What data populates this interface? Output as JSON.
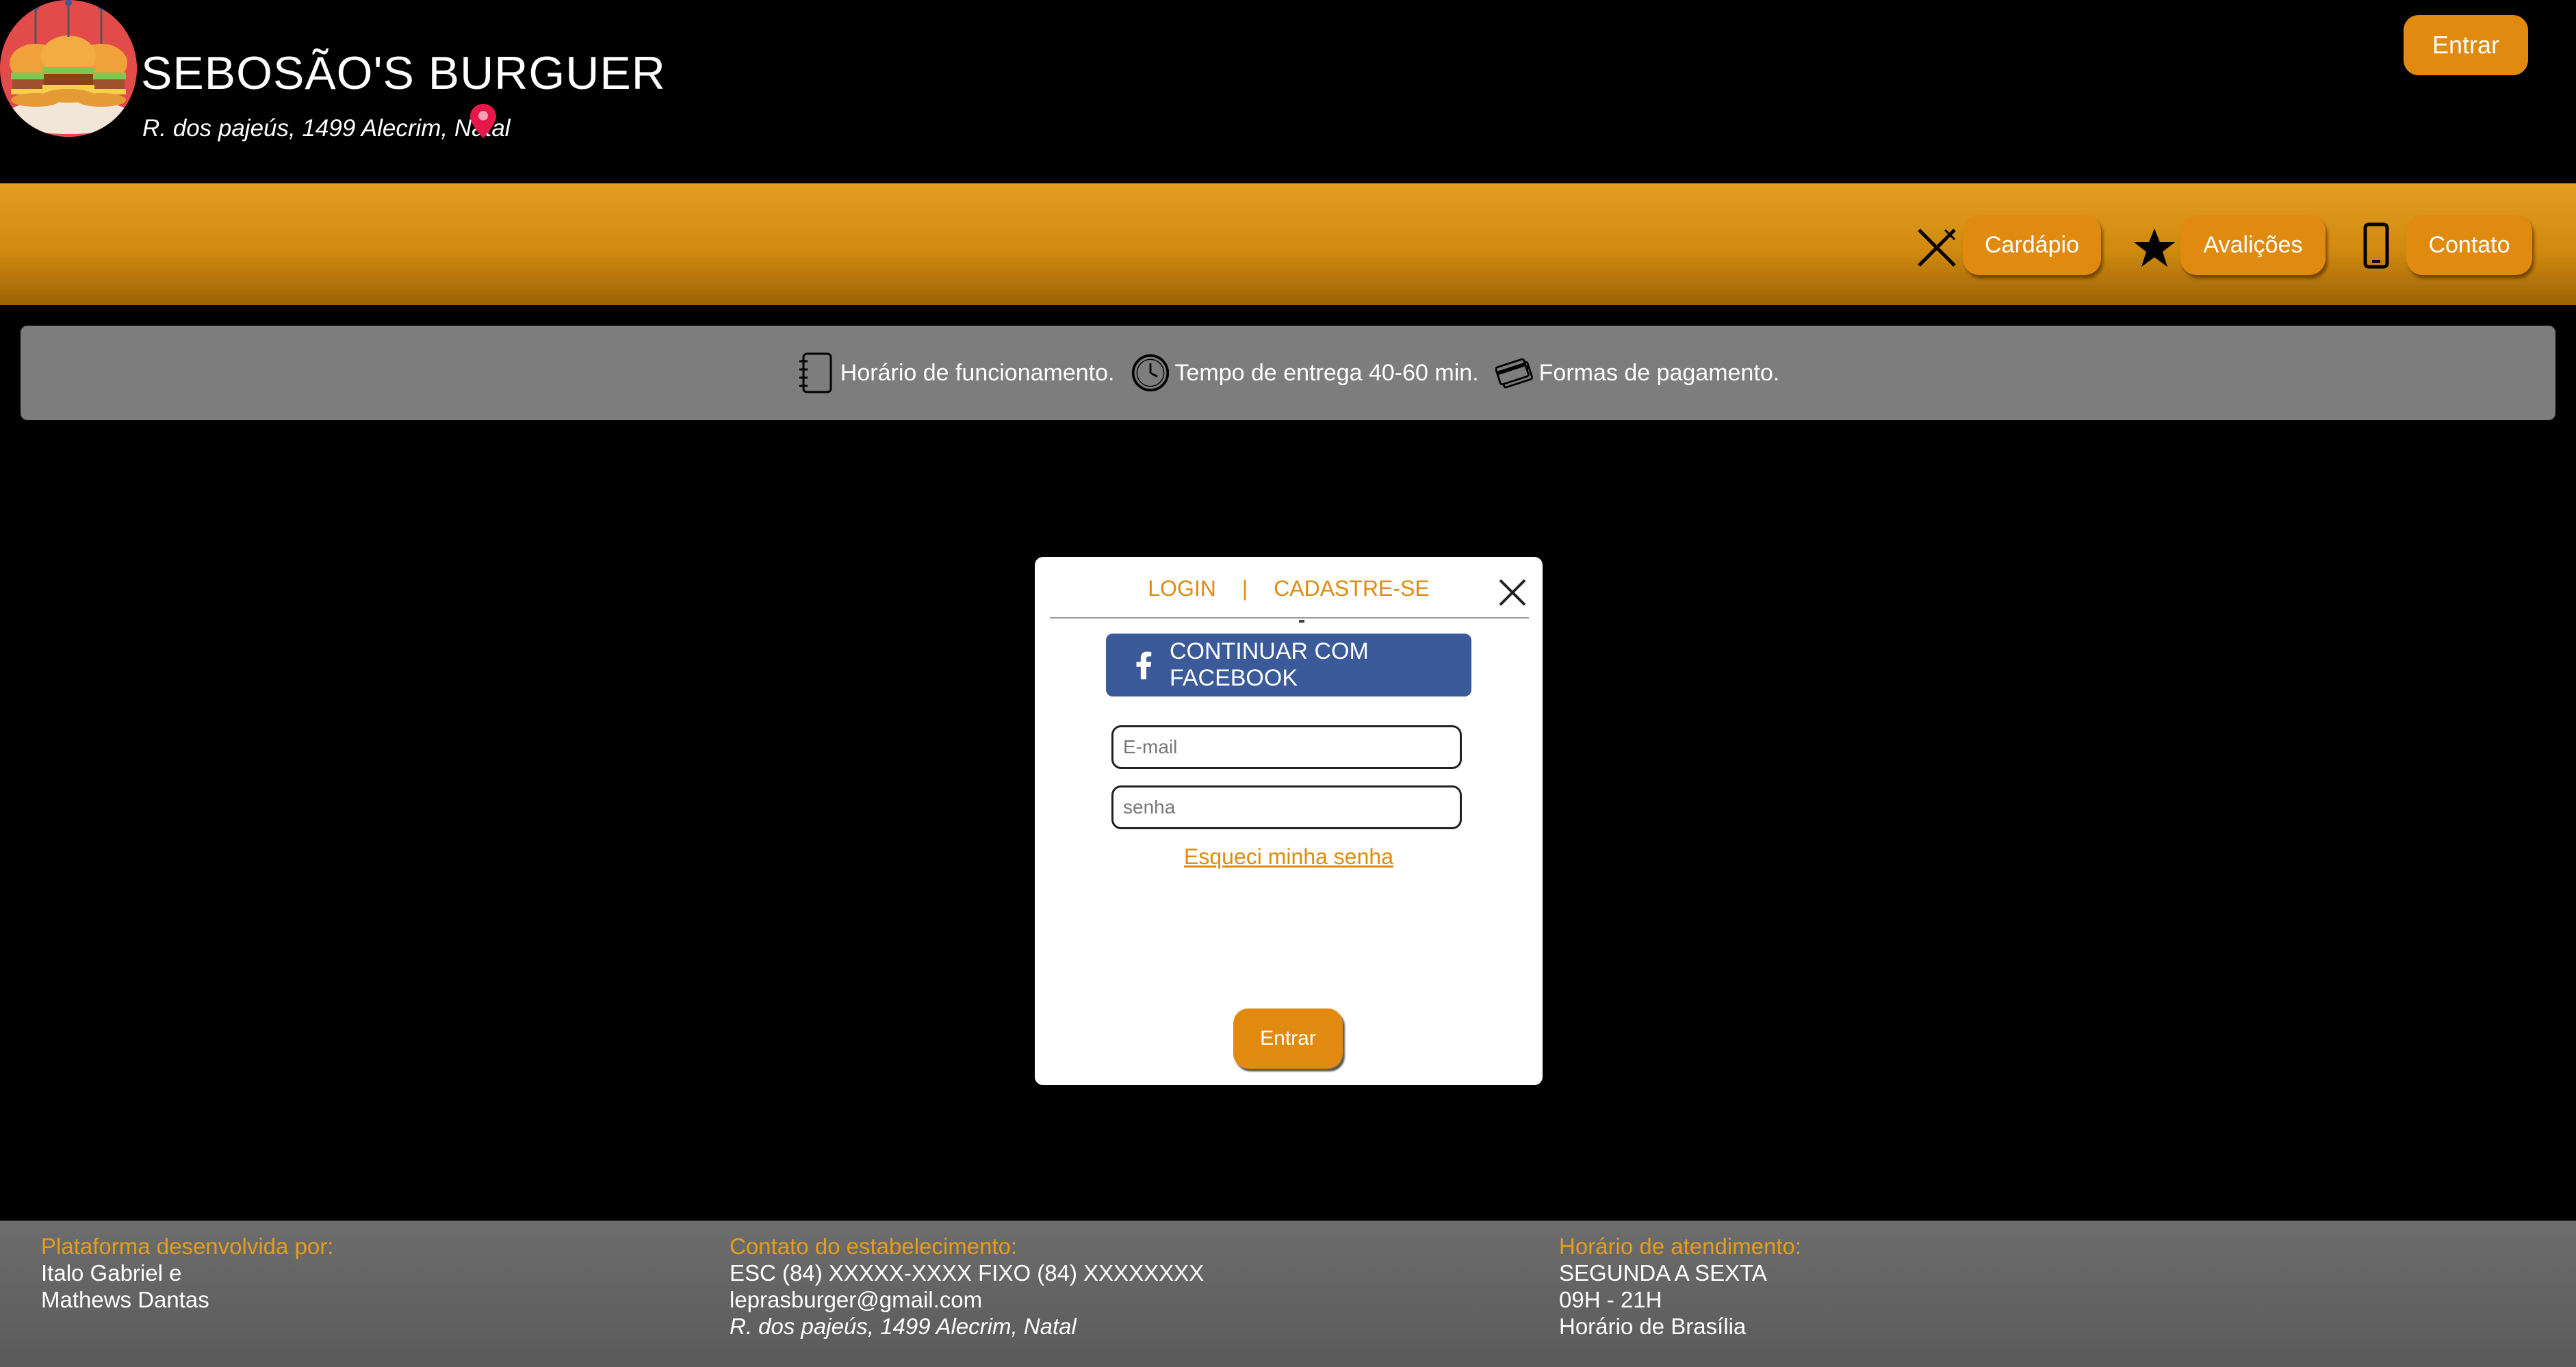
{
  "header": {
    "brand_name": "SEBOSÃO'S BURGUER",
    "address": "R. dos pajeús, 1499 Alecrim, Natal",
    "login_button": "Entrar",
    "logo_icon": "burger-logo-icon",
    "pin_icon": "map-pin-icon"
  },
  "nav": {
    "items": [
      {
        "label": "Cardápio",
        "icon": "fork-knife-icon"
      },
      {
        "label": "Avalições",
        "icon": "star-icon"
      },
      {
        "label": "Contato",
        "icon": "phone-icon"
      }
    ]
  },
  "info": {
    "items": [
      {
        "label": "Horário de funcionamento.",
        "icon": "notebook-icon"
      },
      {
        "label": "Tempo de entrega 40-60 min.",
        "icon": "clock-icon"
      },
      {
        "label": "Formas de pagamento.",
        "icon": "credit-card-icon"
      }
    ]
  },
  "modal": {
    "tab_login": "LOGIN",
    "tab_separator": "|",
    "tab_signup": "CADASTRE-SE",
    "facebook_button": "CONTINUAR COM FACEBOOK",
    "email_placeholder": "E-mail",
    "password_placeholder": "senha",
    "forgot_password": "Esqueci minha senha",
    "submit_button": "Entrar"
  },
  "footer": {
    "developers": {
      "heading": "Plataforma desenvolvida por:",
      "lines": [
        "Italo Gabriel e",
        "Mathews Dantas"
      ]
    },
    "contact": {
      "heading": "Contato do estabelecimento:",
      "phones": "ESC (84) XXXXX-XXXX FIXO (84) XXXXXXXX",
      "email": "leprasburger@gmail.com",
      "address": "R. dos pajeús, 1499 Alecrim, Natal"
    },
    "hours": {
      "heading": "Horário de atendimento:",
      "lines": [
        "SEGUNDA A SEXTA",
        "09H - 21H",
        "Horário de Brasília"
      ]
    }
  },
  "colors": {
    "accent": "#e08a10",
    "facebook": "#3b5a9a",
    "info_bar": "#7d7d7d",
    "background": "#000000"
  }
}
